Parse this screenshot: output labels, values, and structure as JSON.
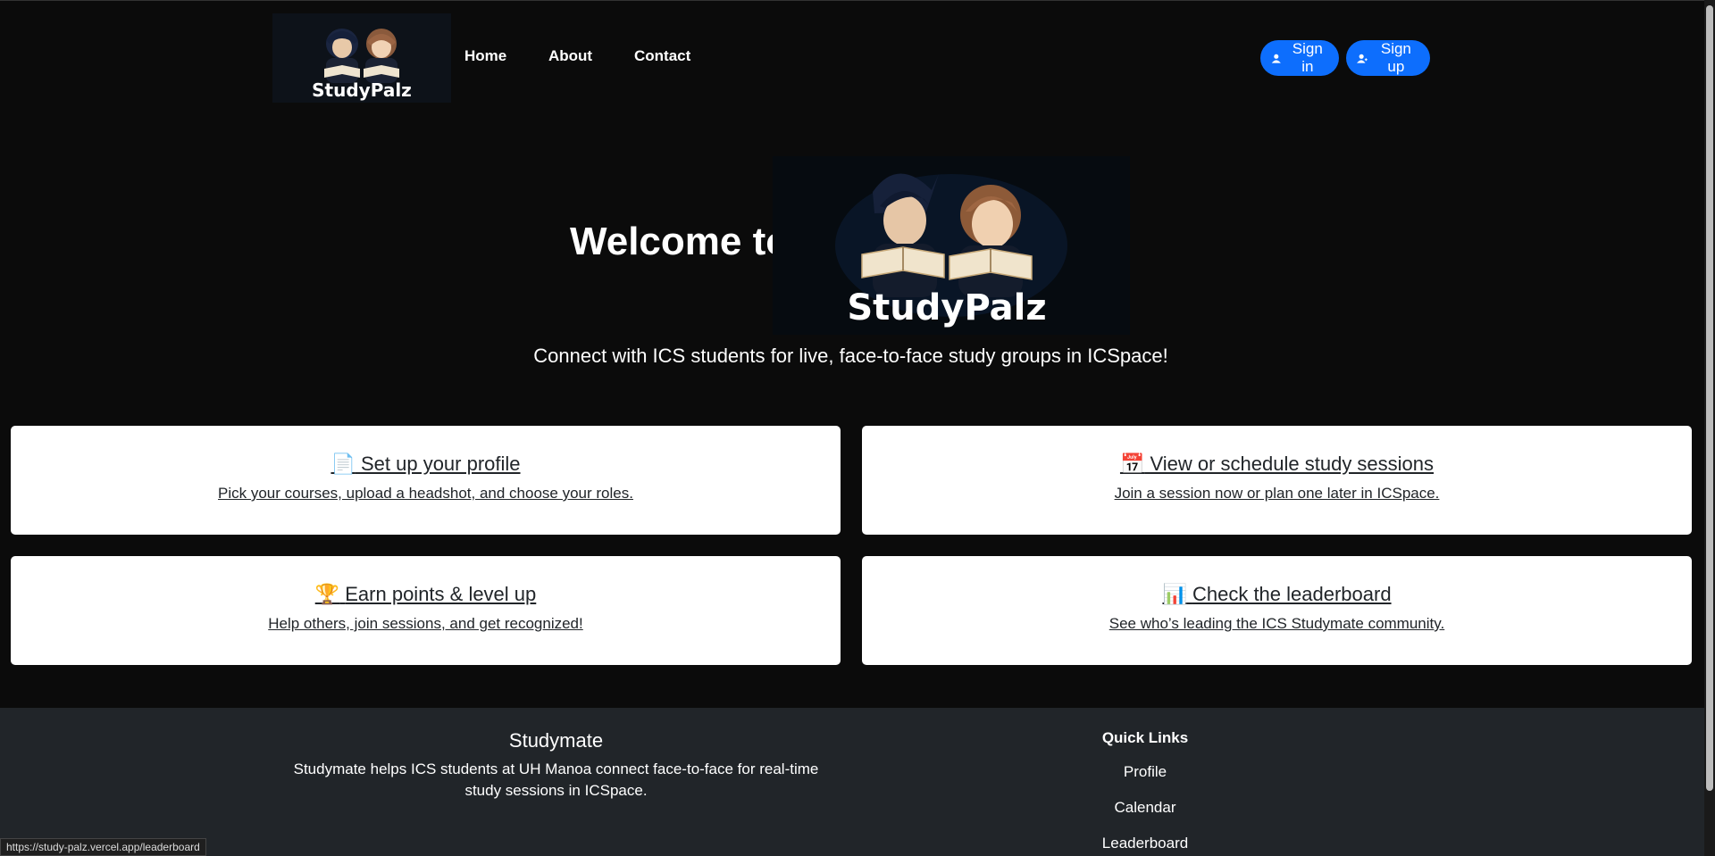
{
  "nav": {
    "logo_text": "StudyPalz",
    "links": [
      "Home",
      "About",
      "Contact"
    ],
    "sign_in_label": "Sign in",
    "sign_up_label": "Sign up"
  },
  "hero": {
    "title": "Welcome to",
    "logo_text": "StudyPalz",
    "tagline": "Connect with ICS students for live, face-to-face study groups in ICSpace!"
  },
  "cards": [
    {
      "emoji": "📄",
      "title": "Set up your profile",
      "desc": "Pick your courses, upload a headshot, and choose your roles."
    },
    {
      "emoji": "📅",
      "title": "View or schedule study sessions",
      "desc": "Join a session now or plan one later in ICSpace."
    },
    {
      "emoji": "🏆",
      "title": "Earn points & level up",
      "desc": "Help others, join sessions, and get recognized!"
    },
    {
      "emoji": "📊",
      "title": "Check the leaderboard",
      "desc": "See who’s leading the ICS Studymate community."
    }
  ],
  "footer": {
    "brand": "Studymate",
    "description": "Studymate helps ICS students at UH Manoa connect face-to-face for real-time study sessions in ICSpace.",
    "quick_links_heading": "Quick Links",
    "quick_links": [
      "Profile",
      "Calendar",
      "Leaderboard"
    ]
  },
  "status_url": "https://study-palz.vercel.app/leaderboard",
  "colors": {
    "background": "#0b0b0b",
    "primary_button": "#0d6efd",
    "footer_bg": "#212529",
    "card_bg": "#ffffff"
  }
}
